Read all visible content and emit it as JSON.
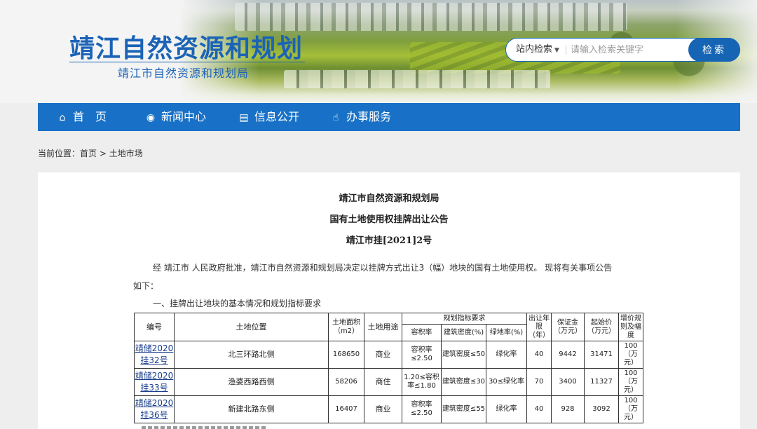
{
  "header": {
    "title": "靖江自然资源和规划",
    "subtitle": "靖江市自然资源和规划局",
    "search": {
      "scope": "站内检索",
      "placeholder": "请输入检索关键字",
      "button": "检索"
    }
  },
  "nav": [
    {
      "label": "首　页",
      "icon": "home-icon",
      "glyph": "⌂"
    },
    {
      "label": "新闻中心",
      "icon": "globe-icon",
      "glyph": "◉"
    },
    {
      "label": "信息公开",
      "icon": "document-icon",
      "glyph": "▤"
    },
    {
      "label": "办事服务",
      "icon": "thumbs-up-icon",
      "glyph": "☝"
    }
  ],
  "breadcrumb": {
    "prefix": "当前位置：",
    "home": "首页",
    "sep": ">",
    "current": "土地市场"
  },
  "notice": {
    "org": "靖江市自然资源和规划局",
    "title": "国有土地使用权挂牌出让公告",
    "number": "靖江市挂[2021]2号",
    "intro": "经 靖江市 人民政府批准，靖江市自然资源和规划局决定以挂牌方式出让3（幅）地块的国有土地使用权。 现将有关事项公告",
    "intro2": "如下：",
    "section1": "一、挂牌出让地块的基本情况和规划指标要求"
  },
  "table": {
    "headers": {
      "id": "编号",
      "location": "土地位置",
      "area": "土地面积（m2）",
      "use": "土地用途",
      "planning": "规划指标要求",
      "far": "容积率",
      "density": "建筑密度(%)",
      "green": "绿地率(%)",
      "term": "出让年限（年）",
      "deposit": "保证金（万元）",
      "start_price": "起始价（万元）",
      "increment": "增价规则及幅度"
    },
    "rows": [
      {
        "id": "靖储2020挂32号",
        "location": "北三环路北侧",
        "area": "168650",
        "use": "商业",
        "far": "容积率≤2.50",
        "density": "建筑密度≤50",
        "green": "绿化率",
        "term": "40",
        "deposit": "9442",
        "start_price": "31471",
        "increment": "100（万元）"
      },
      {
        "id": "靖储2020挂33号",
        "location": "渔婆西路西侧",
        "area": "58206",
        "use": "商住",
        "far": "1.20≤容积率≤1.80",
        "density": "建筑密度≤30",
        "green": "30≤绿化率",
        "term": "70",
        "deposit": "3400",
        "start_price": "11327",
        "increment": "100（万元）"
      },
      {
        "id": "靖储2020挂36号",
        "location": "新建北路东侧",
        "area": "16407",
        "use": "商业",
        "far": "容积率≤2.50",
        "density": "建筑密度≤55",
        "green": "绿化率",
        "term": "40",
        "deposit": "928",
        "start_price": "3092",
        "increment": "100（万元）"
      }
    ]
  },
  "colors": {
    "brand": "#1b63b7",
    "nav": "#1871c6",
    "page_bg": "#eeeeee"
  }
}
